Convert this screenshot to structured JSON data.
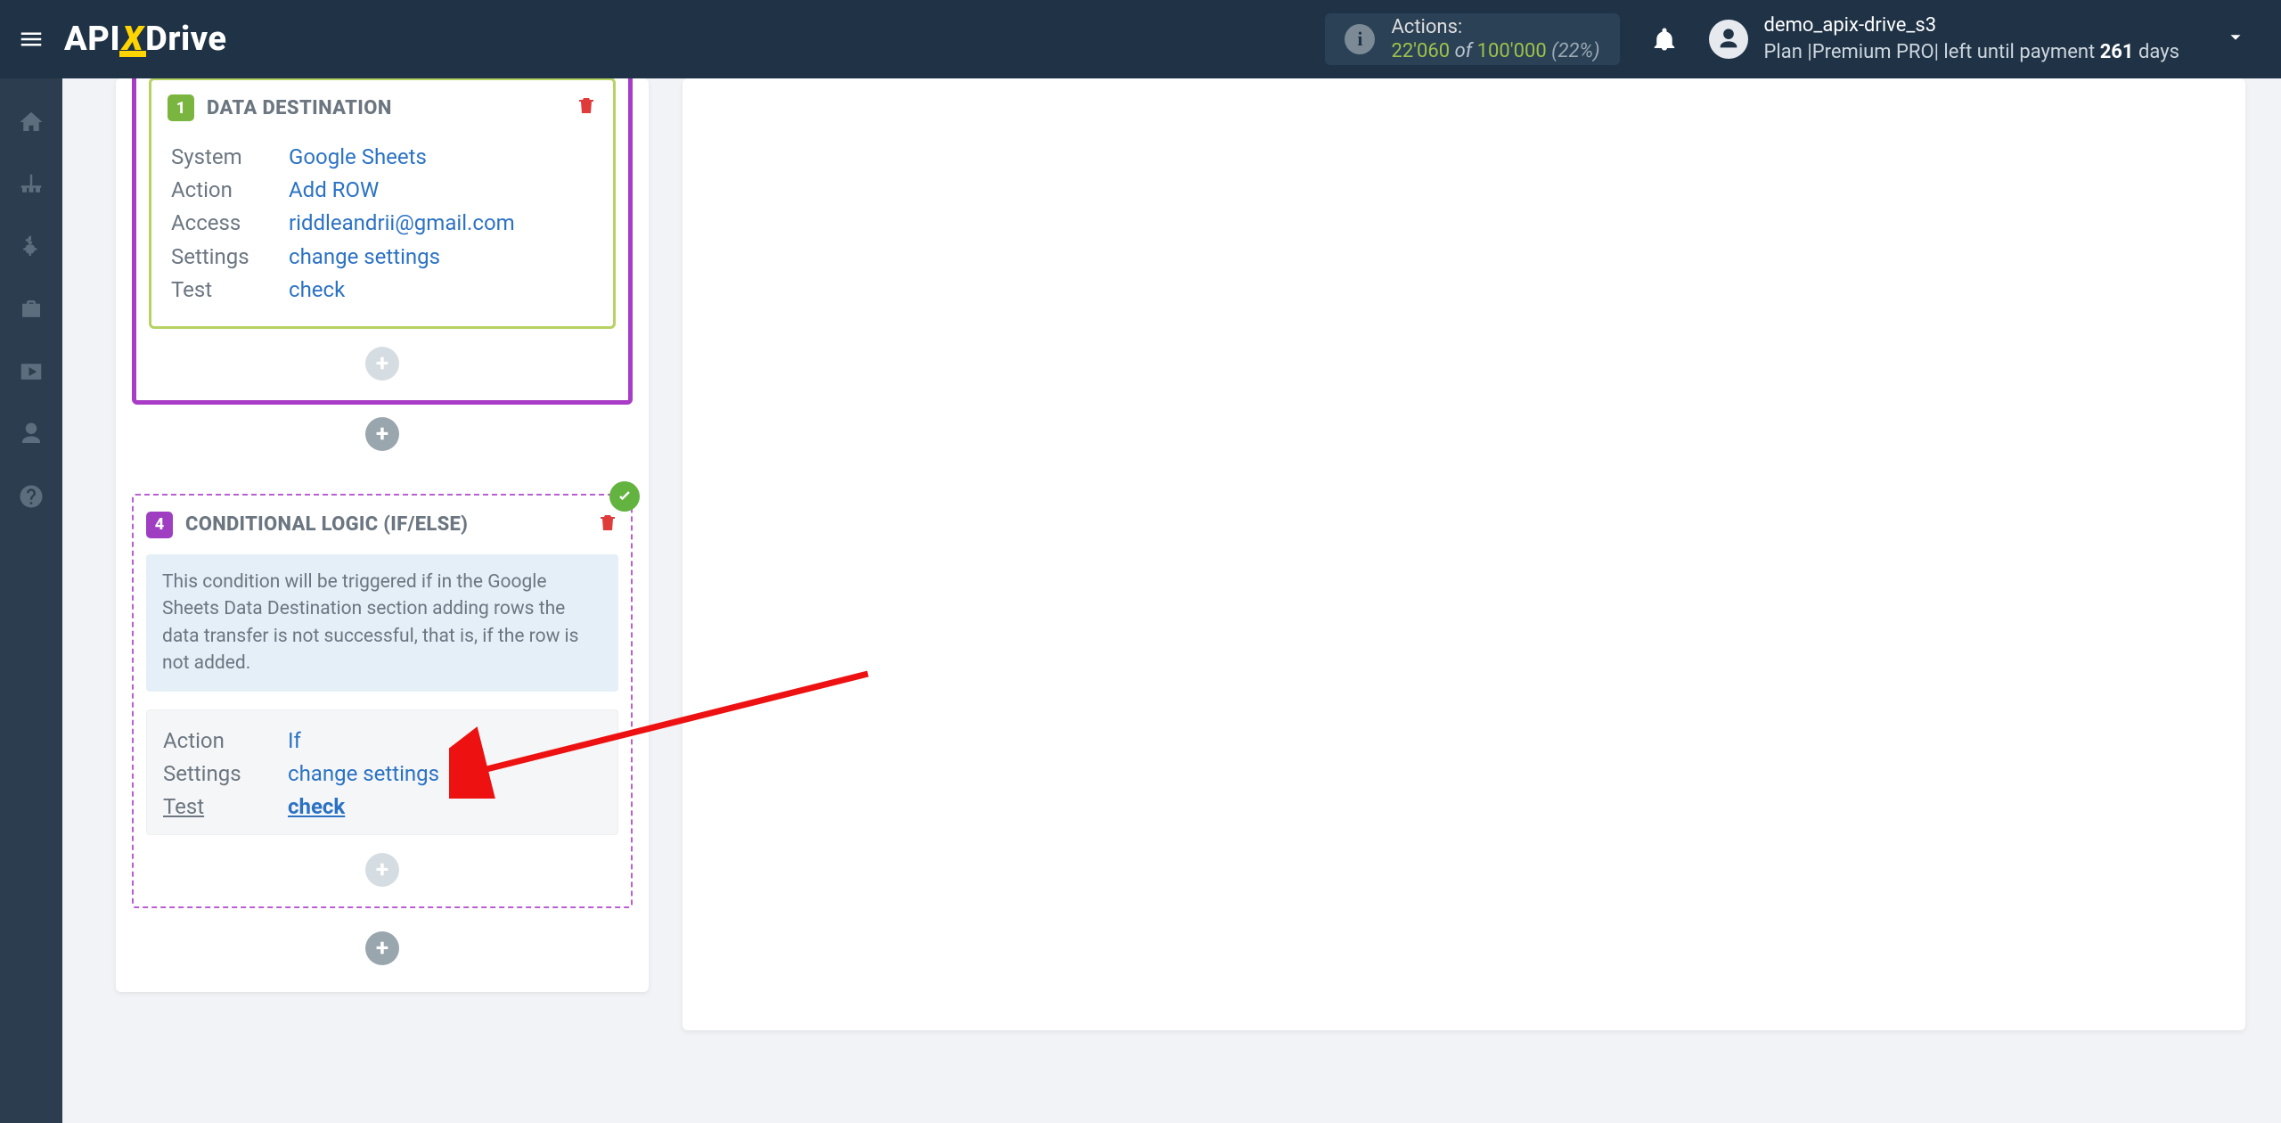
{
  "brand": {
    "api": "API",
    "x": "X",
    "drive": "Drive"
  },
  "actions": {
    "label": "Actions:",
    "used": "22'060",
    "of": "of",
    "total": "100'000",
    "pct": "(22%)"
  },
  "user": {
    "name": "demo_apix-drive_s3",
    "plan_prefix": "Plan |Premium PRO| left until payment ",
    "days": "261",
    "plan_suffix": " days"
  },
  "block1": {
    "num": "1",
    "title": "DATA DESTINATION",
    "rows": {
      "system_k": "System",
      "system_v": "Google Sheets",
      "action_k": "Action",
      "action_v": "Add ROW",
      "access_k": "Access",
      "access_v": "riddleandrii@gmail.com",
      "settings_k": "Settings",
      "settings_v": "change settings",
      "test_k": "Test",
      "test_v": "check"
    }
  },
  "block2": {
    "num": "4",
    "title": "CONDITIONAL LOGIC (IF/ELSE)",
    "note": "This condition will be triggered if in the Google Sheets Data Destination section adding rows the data transfer is not successful, that is, if the row is not added.",
    "rows": {
      "action_k": "Action",
      "action_v": "If",
      "settings_k": "Settings",
      "settings_v": "change settings",
      "test_k": "Test",
      "test_v": "check"
    }
  }
}
